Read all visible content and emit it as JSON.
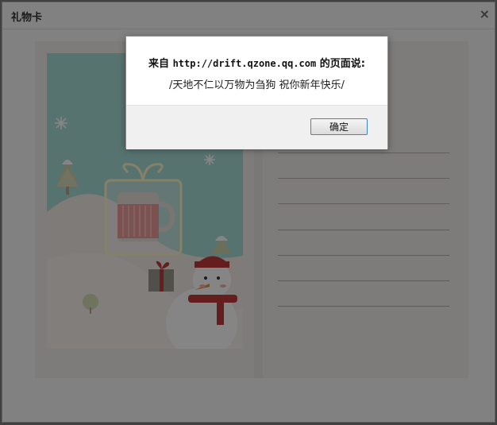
{
  "window": {
    "title": "礼物卡",
    "close_label": "×"
  },
  "dialog": {
    "prefix": "来自 ",
    "url": "http://drift.qzone.qq.com",
    "suffix": " 的页面说:",
    "message": "/天地不仁以万物为刍狗 祝你新年快乐/",
    "ok_label": "确定"
  },
  "colors": {
    "overlay": "#000000",
    "dialog_button_border": "#3a86c8",
    "card_sky": "#a8dcd6",
    "mug_sleeve": "#ee9d9b",
    "scarf": "#c23a3a"
  },
  "icons": [
    "close-icon",
    "snowflake-icon",
    "gift-box-icon",
    "snowman-icon",
    "tree-icon"
  ]
}
